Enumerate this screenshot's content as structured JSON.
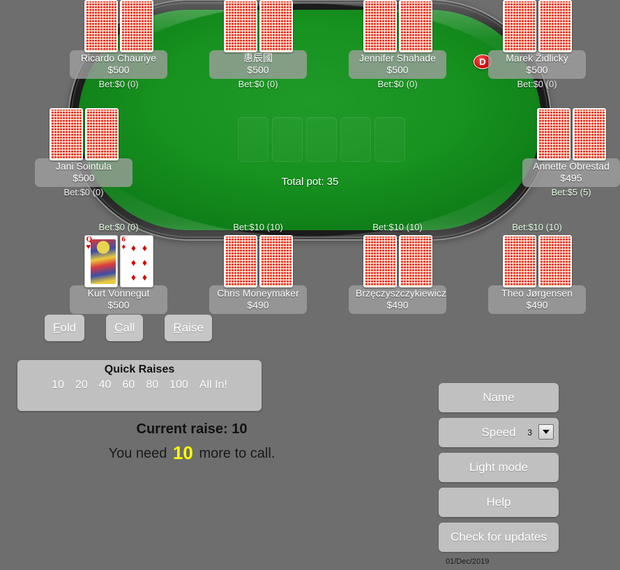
{
  "table": {
    "total_pot_label": "Total pot: 35",
    "community_card_slots": 5,
    "felt_color": "#17911f",
    "dealer_button_label": "D",
    "dealer_button_color": "#d00b0b"
  },
  "seats": [
    {
      "name": "Ricardo Chauriye",
      "stack": "$500",
      "bet": "Bet:$0 (0)",
      "cards": "back"
    },
    {
      "name": "惠辰國",
      "stack": "$500",
      "bet": "Bet:$0 (0)",
      "cards": "back"
    },
    {
      "name": "Jennifer Shahade",
      "stack": "$500",
      "bet": "Bet:$0 (0)",
      "cards": "back"
    },
    {
      "name": "Marek Židlický",
      "stack": "$500",
      "bet": "Bet:$0 (0)",
      "cards": "back"
    },
    {
      "name": "Jani Sointula",
      "stack": "$500",
      "bet": "Bet:$0 (0)",
      "cards": "back"
    },
    {
      "name": "Annette Obrestad",
      "stack": "$495",
      "bet": "Bet:$5 (5)",
      "cards": "back"
    },
    {
      "name": "Kurt Vonnegut",
      "stack": "$500",
      "bet": "Bet:$0 (0)",
      "cards": "face",
      "hole_cards": [
        {
          "rank": "Q",
          "suit": "♥",
          "color": "red",
          "type": "court"
        },
        {
          "rank": "6",
          "suit": "♦",
          "color": "red",
          "type": "pip"
        }
      ]
    },
    {
      "name": "Chris Moneymaker",
      "stack": "$490",
      "bet": "Bet:$10 (10)",
      "cards": "back"
    },
    {
      "name": "Brzęczyszczykiewicz",
      "stack": "$490",
      "bet": "Bet:$10 (10)",
      "cards": "back"
    },
    {
      "name": "Theo Jørgensen",
      "stack": "$490",
      "bet": "Bet:$10 (10)",
      "cards": "back"
    }
  ],
  "actions": {
    "fold": {
      "accel": "F",
      "rest": "old"
    },
    "call": {
      "accel": "C",
      "rest": "all"
    },
    "raise": {
      "accel": "R",
      "rest": "aise"
    }
  },
  "quick_raises": {
    "title": "Quick Raises",
    "options": [
      "10",
      "20",
      "40",
      "60",
      "80",
      "100",
      "All In!"
    ]
  },
  "status": {
    "current_raise": "Current raise: 10",
    "need_prefix": "You need ",
    "need_amount": "10",
    "need_suffix": " more to call.",
    "need_amount_color": "#ffff00"
  },
  "menu": {
    "name_label": "Name",
    "speed_label": "Speed",
    "speed_value": "3",
    "light_mode_label": "Light mode",
    "help_label": "Help",
    "check_updates_label": "Check for updates"
  },
  "build_date": "01/Dec/2019"
}
